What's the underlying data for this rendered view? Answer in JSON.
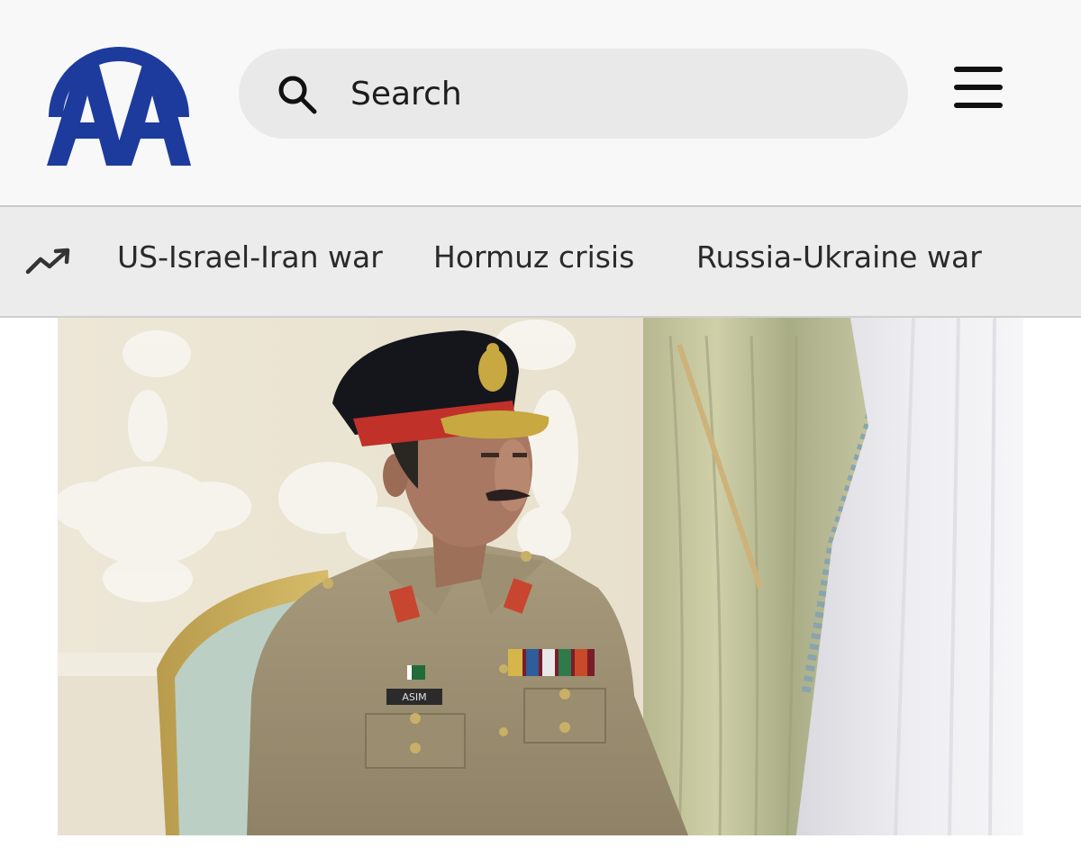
{
  "header": {
    "logo": {
      "text": "AA",
      "color": "#1d3b9c"
    },
    "search": {
      "placeholder": "Search",
      "icon": "search-icon"
    },
    "menu_icon": "hamburger-menu-icon"
  },
  "trending": {
    "icon": "trending-up-icon",
    "items": [
      {
        "label": "US-Israel-Iran war"
      },
      {
        "label": "Hormuz crisis"
      },
      {
        "label": "Russia-Ukraine war"
      }
    ]
  },
  "article": {
    "photo_badge_text": "ASIM"
  },
  "colors": {
    "brand_blue": "#1d3b9c",
    "text_dark": "#2a2a2a",
    "header_bg": "#f8f8f8",
    "trend_bar_bg": "#ececec"
  }
}
